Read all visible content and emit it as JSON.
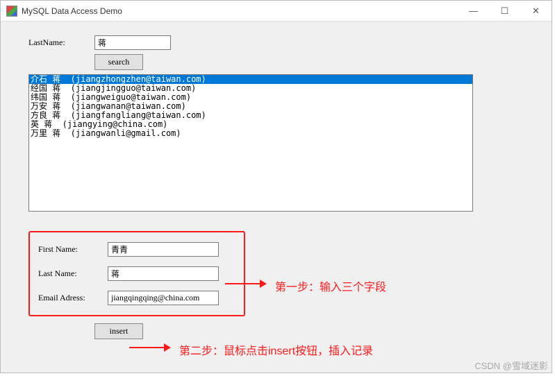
{
  "window": {
    "title": "MySQL Data Access Demo"
  },
  "search": {
    "lastname_label": "LastName:",
    "lastname_value": "蒋",
    "button_label": "search"
  },
  "listbox": {
    "items": [
      "介石 蒋  (jiangzhongzhen@taiwan.com)",
      "经国 蒋  (jiangjingguo@taiwan.com)",
      "纬国 蒋  (jiangweiguo@taiwan.com)",
      "万安 蒋  (jiangwanan@taiwan.com)",
      "方良 蒋  (jiangfangliang@taiwan.com)",
      "英 蒋  (jiangying@china.com)",
      "万里 蒋  (jiangwanli@gmail.com)"
    ],
    "selected_index": 0
  },
  "insert": {
    "first_name_label": "First Name:",
    "first_name_value": "青青",
    "last_name_label": "Last Name:",
    "last_name_value": "蒋",
    "email_label": "Email Adress:",
    "email_value": "jiangqingqing@china.com",
    "button_label": "insert"
  },
  "annotations": {
    "step1": "第一步：输入三个字段",
    "step2": "第二步：鼠标点击insert按钮，插入记录"
  },
  "watermark": "CSDN @雪域迷影"
}
